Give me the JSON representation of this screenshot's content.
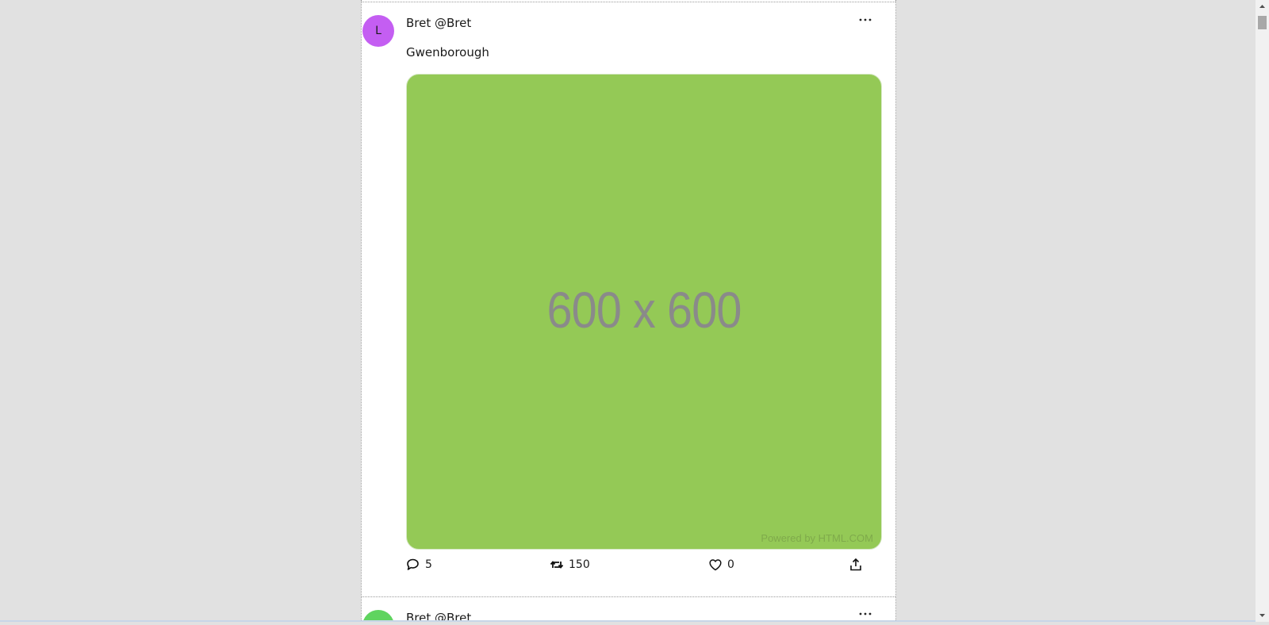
{
  "colors": {
    "page_background": "#e1e1e1",
    "feed_background": "#ffffff",
    "media_placeholder": "#94c956"
  },
  "posts": [
    {
      "avatar": {
        "letter": "L",
        "color": "#c45ef2"
      },
      "author": "Bret @Bret",
      "text": "Gwenborough",
      "media": {
        "placeholder_text": "600 x 600",
        "credit": "Powered by HTML.COM"
      },
      "actions": {
        "reply": {
          "icon": "speech-bubble-icon",
          "count": "5"
        },
        "retweet": {
          "icon": "retweet-icon",
          "count": "150"
        },
        "like": {
          "icon": "heart-icon",
          "count": "0"
        },
        "share": {
          "icon": "share-icon"
        }
      },
      "more_icon": "ellipsis-icon"
    },
    {
      "avatar": {
        "letter": "",
        "color": "#5fd45f"
      },
      "author": "Bret @Bret",
      "more_icon": "ellipsis-icon"
    }
  ]
}
